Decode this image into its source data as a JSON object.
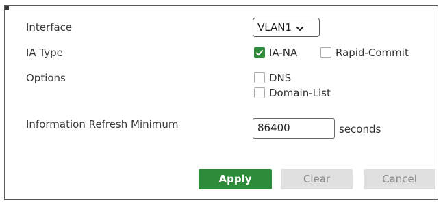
{
  "form": {
    "interface": {
      "label": "Interface",
      "selected": "VLAN1"
    },
    "ia_type": {
      "label": "IA Type",
      "options": [
        {
          "text": "IA-NA",
          "checked": true
        },
        {
          "text": "Rapid-Commit",
          "checked": false
        }
      ]
    },
    "options": {
      "label": "Options",
      "items": [
        {
          "text": "DNS",
          "checked": false
        },
        {
          "text": "Domain-List",
          "checked": false
        }
      ]
    },
    "refresh": {
      "label": "Information Refresh Minimum",
      "value": "86400",
      "unit": "seconds"
    }
  },
  "buttons": {
    "apply": "Apply",
    "clear": "Clear",
    "cancel": "Cancel"
  },
  "colors": {
    "accent": "#2e8b3a",
    "button_disabled": "#e0e0e0"
  },
  "icons": {
    "select_arrow": "chevron-down-icon",
    "checkmark": "checkmark-icon"
  }
}
